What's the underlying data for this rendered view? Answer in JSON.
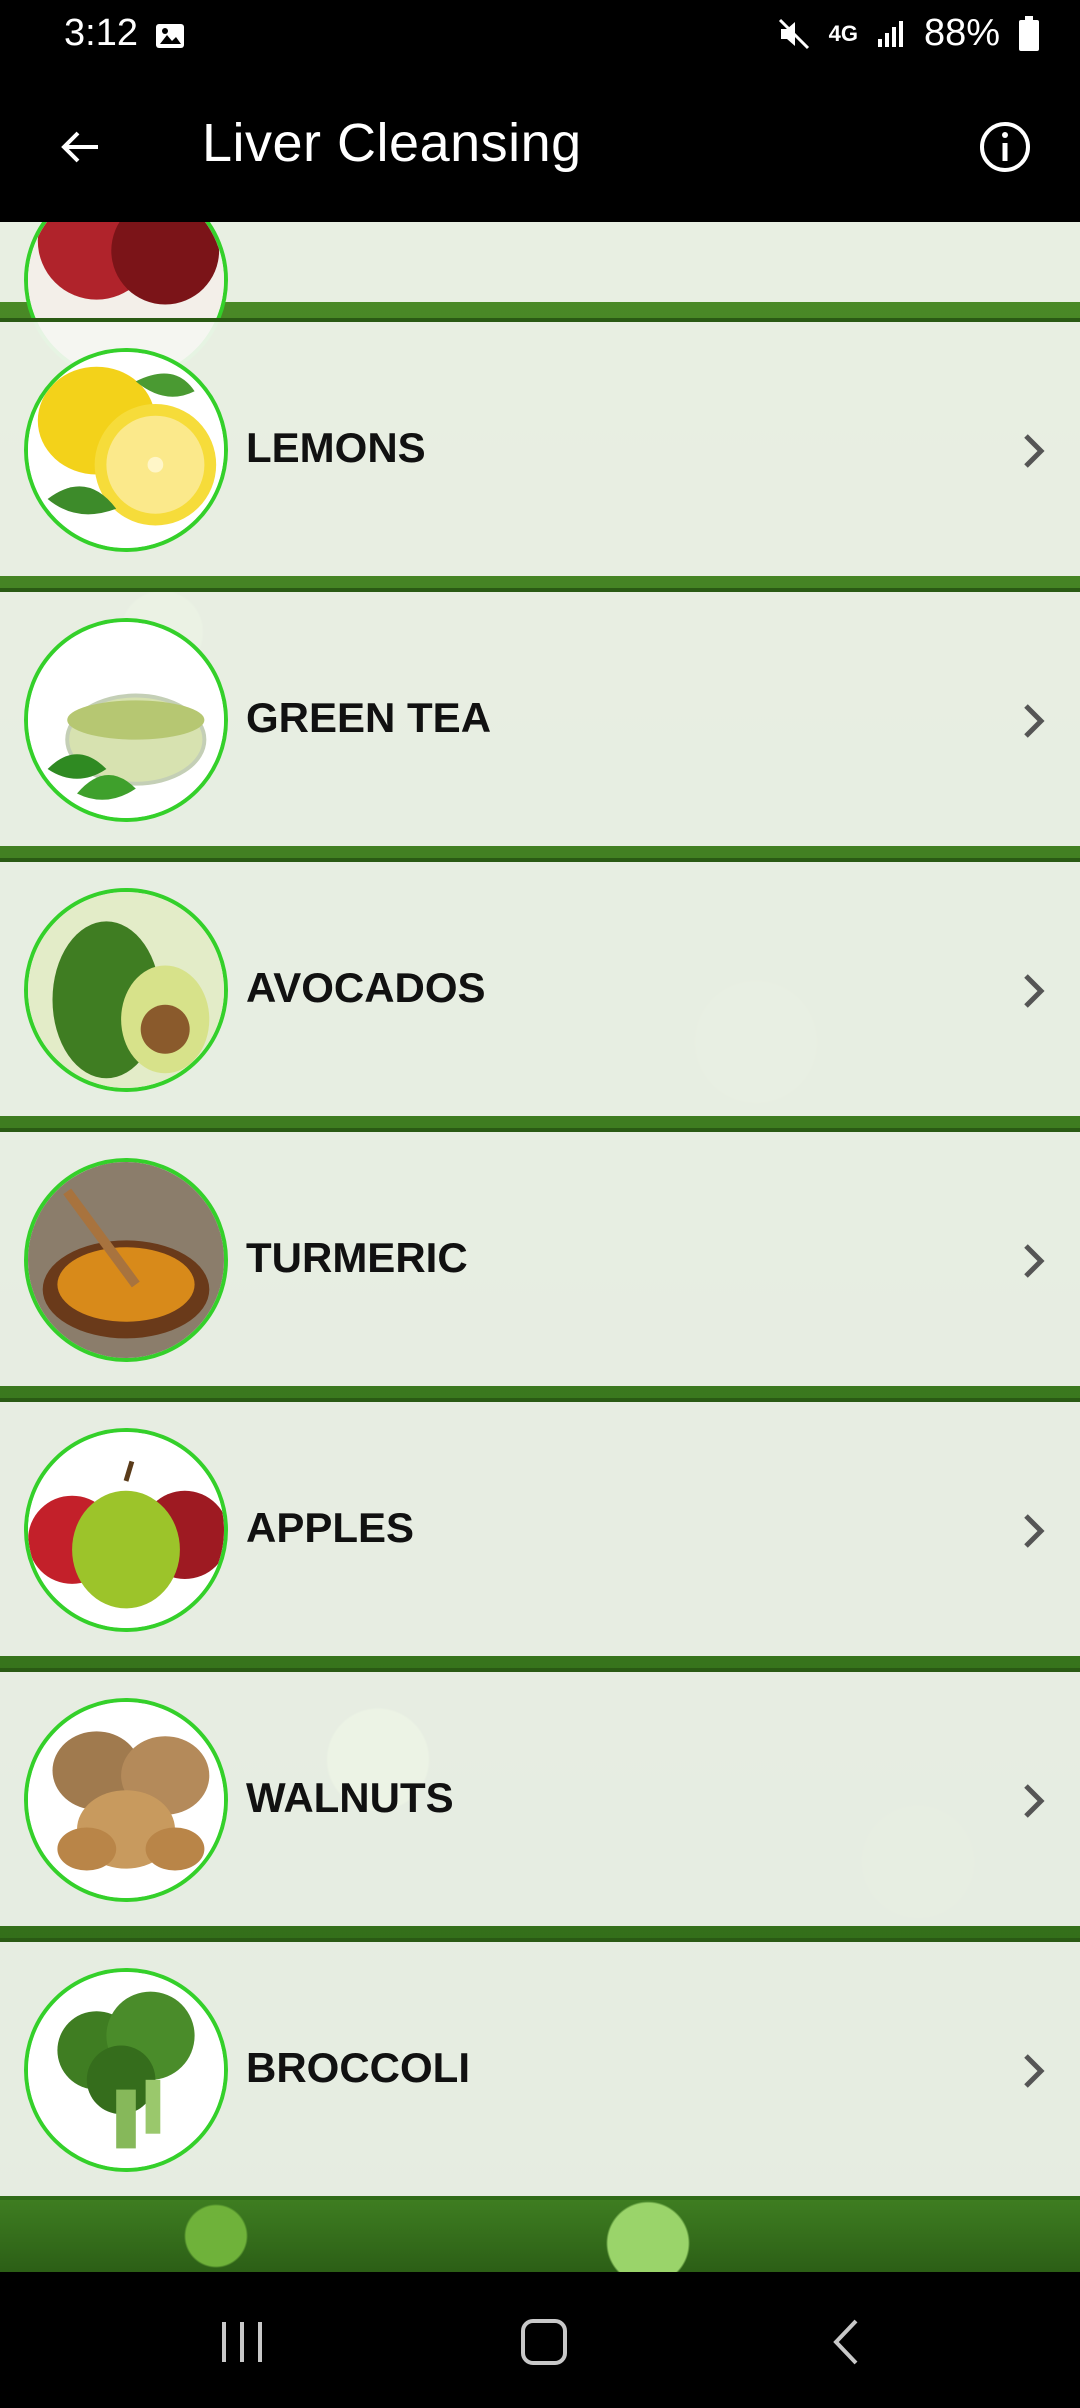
{
  "status_bar": {
    "time": "3:12",
    "network": "4G",
    "battery_percent": "88%",
    "icons": [
      "image-icon",
      "mute-icon",
      "network-icon",
      "signal-icon",
      "battery-icon"
    ]
  },
  "app_bar": {
    "title": "Liver Cleansing",
    "back_icon": "back-arrow-icon",
    "info_icon": "info-icon"
  },
  "list": {
    "items": [
      {
        "label": "LEMONS",
        "icon": "lemon-image"
      },
      {
        "label": "GREEN TEA",
        "icon": "green-tea-image"
      },
      {
        "label": "AVOCADOS",
        "icon": "avocado-image"
      },
      {
        "label": "TURMERIC",
        "icon": "turmeric-image"
      },
      {
        "label": "APPLES",
        "icon": "apples-image"
      },
      {
        "label": "WALNUTS",
        "icon": "walnuts-image"
      },
      {
        "label": "BROCCOLI",
        "icon": "broccoli-image"
      }
    ]
  },
  "nav_bar": {
    "icons": [
      "recent-apps-icon",
      "home-icon",
      "back-icon"
    ]
  },
  "colors": {
    "app_bar_bg": "#000000",
    "item_border": "#34d02a",
    "item_bg": "#f4f6f1"
  }
}
